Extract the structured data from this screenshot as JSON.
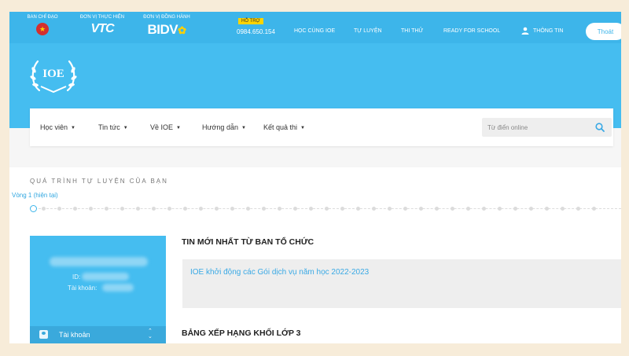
{
  "topbar": {
    "sponsors": [
      {
        "label": "BAN CHỈ ĐẠO",
        "logo": "emblem-icon"
      },
      {
        "label": "ĐƠN VỊ THỰC HIỆN",
        "logo_text": "VTC"
      },
      {
        "label": "ĐƠN VỊ ĐỒNG HÀNH",
        "logo_text": "BIDV"
      }
    ],
    "support_label": "HỖ TRỢ",
    "phone": "0984.650.154",
    "links": [
      "HỌC CÙNG IOE",
      "TỰ LUYỆN",
      "THI THỬ",
      "READY FOR SCHOOL"
    ],
    "account_label": "THÔNG TIN",
    "logout_label": "Thoát"
  },
  "logo": {
    "text": "IOE"
  },
  "nav": {
    "items": [
      "Học viên",
      "Tin tức",
      "Về IOE",
      "Hướng dẫn",
      "Kết quả thi"
    ],
    "search_placeholder": "Từ điển online"
  },
  "progress": {
    "title": "QUÁ TRÌNH TỰ LUYỆN CỦA BẠN",
    "current_round": "Vòng 1 (hiện tại)"
  },
  "profile": {
    "id_label": "ID:",
    "account_label": "Tài khoản:",
    "account_menu": "Tài khoản"
  },
  "news": {
    "title": "TIN MỚI NHẤT TỪ BAN TỔ CHỨC",
    "items": [
      "IOE khởi động các Gói dịch vụ năm học 2022-2023"
    ]
  },
  "ranking": {
    "title": "BẢNG XẾP HẠNG KHỐI LỚP 3"
  },
  "colors": {
    "primary": "#3db5ea",
    "hero": "#45bdf0",
    "accent_yellow": "#ffd400",
    "link": "#3aa9e5"
  }
}
